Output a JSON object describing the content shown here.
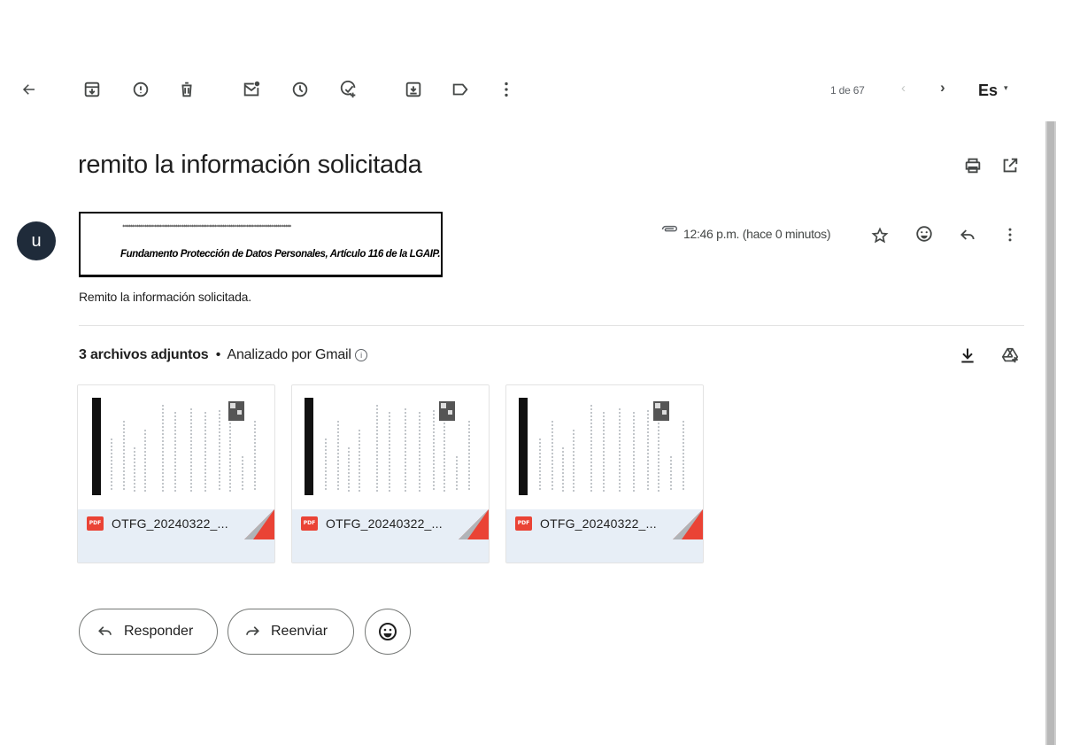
{
  "toolbar": {
    "back_icon": "arrow-back-icon",
    "actions": [
      "archive-icon",
      "report-spam-icon",
      "delete-icon",
      "mark-unread-icon",
      "snooze-icon",
      "add-task-icon",
      "move-to-icon",
      "label-icon",
      "more-vert-icon"
    ],
    "counter": "1 de 67",
    "prev": "‹",
    "next": "›",
    "language": "Es",
    "language_caret": "▾"
  },
  "email": {
    "subject": "remito la información solicitada",
    "avatar_letter": "u",
    "sender_redacted": "**************************************************************************************",
    "redaction_basis": "Fundamento Protección de Datos Personales, Artículo 116 de la LGAIP.",
    "timestamp": "12:46 p.m. (hace 0 minutos)",
    "body": "Remito la información solicitada."
  },
  "attachments": {
    "count_label": "3 archivos adjuntos",
    "separator": "•",
    "scanned_label": "Analizado por Gmail",
    "info_glyph": "i",
    "items": [
      {
        "badge": "PDF",
        "name": "OTFG_20240322_..."
      },
      {
        "badge": "PDF",
        "name": "OTFG_20240322_..."
      },
      {
        "badge": "PDF",
        "name": "OTFG_20240322_..."
      }
    ]
  },
  "actions": {
    "reply": "Responder",
    "forward": "Reenviar"
  },
  "colors": {
    "pdf_red": "#ea4335",
    "avatar_bg": "#1f2b3a",
    "card_footer": "#e7eef6"
  }
}
